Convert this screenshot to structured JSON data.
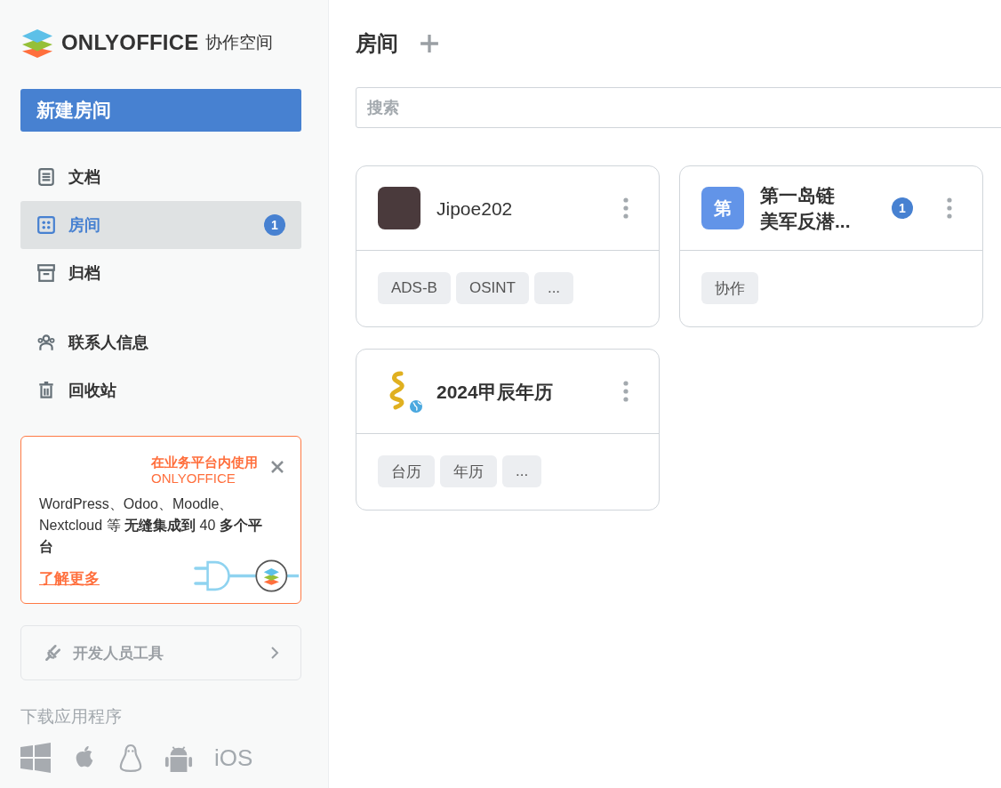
{
  "logo": {
    "brand": "ONLYOFFICE",
    "product": "协作空间"
  },
  "new_room_button": "新建房间",
  "nav": [
    {
      "label": "文档",
      "kind": "document",
      "selected": false
    },
    {
      "label": "房间",
      "kind": "rooms",
      "selected": true,
      "badge": "1"
    },
    {
      "label": "归档",
      "kind": "archive",
      "selected": false
    }
  ],
  "secondary_nav": [
    {
      "label": "联系人信息",
      "kind": "contacts",
      "selected": false
    },
    {
      "label": "回收站",
      "kind": "trash",
      "selected": false
    }
  ],
  "promo": {
    "title": "在业务平台内使用",
    "subtitle": "ONLYOFFICE",
    "body": "WordPress、Odoo、Moodle、Nextcloud 等 **无缝集成到** 40 **多个平台**",
    "link": "了解更多"
  },
  "dev_tools": "开发人员工具",
  "download": {
    "label": "下载应用程序",
    "platforms": [
      {
        "kind": "windows"
      },
      {
        "kind": "apple"
      },
      {
        "kind": "linux"
      },
      {
        "kind": "android"
      },
      {
        "kind": "text",
        "label": "iOS"
      }
    ]
  },
  "header": {
    "title": "房间"
  },
  "search": {
    "placeholder": "搜索"
  },
  "rooms": [
    {
      "title": [
        "Jipoe202"
      ],
      "kind": "photo",
      "bold": false,
      "public": false,
      "tags": [
        "ADS-B",
        "OSINT",
        "..."
      ]
    },
    {
      "title": [
        "第一岛链",
        "美军反潜..."
      ],
      "kind": "letter",
      "letter": "第",
      "bold": true,
      "public": false,
      "badge": "1",
      "tags": [
        "协作"
      ]
    },
    {
      "title": [
        "2024甲辰年历"
      ],
      "kind": "dragon",
      "bold": true,
      "public": true,
      "tags": [
        "台历",
        "年历",
        "..."
      ]
    }
  ]
}
